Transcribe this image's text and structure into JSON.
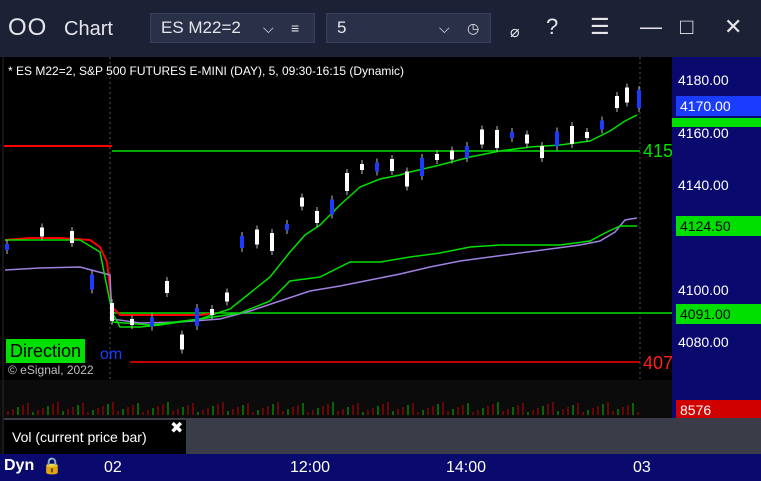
{
  "window": {
    "title": "Chart",
    "symbol": "ES M22=2",
    "interval": "5"
  },
  "chart": {
    "info_line": "* ES M22=2, S&P 500 FUTURES E-MINI (DAY), 5, 09:30-16:15 (Dynamic)",
    "copyright": "© eSignal, 2022",
    "direction_label": "Direction",
    "direction_suffix": "om",
    "left_line_label": "415",
    "bottom_line_label": "407",
    "price_ticks": [
      "4180.00",
      "4160.00",
      "4140.00",
      "4100.00",
      "4080.00"
    ],
    "price_tags": {
      "last": "4170.00",
      "green1": "4124.50",
      "green2": "4091.00",
      "volume": "8576"
    },
    "volume_label": "Vol (current price bar)",
    "dyn_label": "Dyn",
    "time_labels": [
      "02",
      "12:00",
      "14:00",
      "03"
    ],
    "colors": {
      "background": "#000000",
      "axis": "#0a0a6e",
      "green": "#00e000",
      "red": "#ff0000",
      "purple": "#a080e0",
      "candle_up": "#ffffff",
      "candle_down": "#1a3cff"
    }
  }
}
